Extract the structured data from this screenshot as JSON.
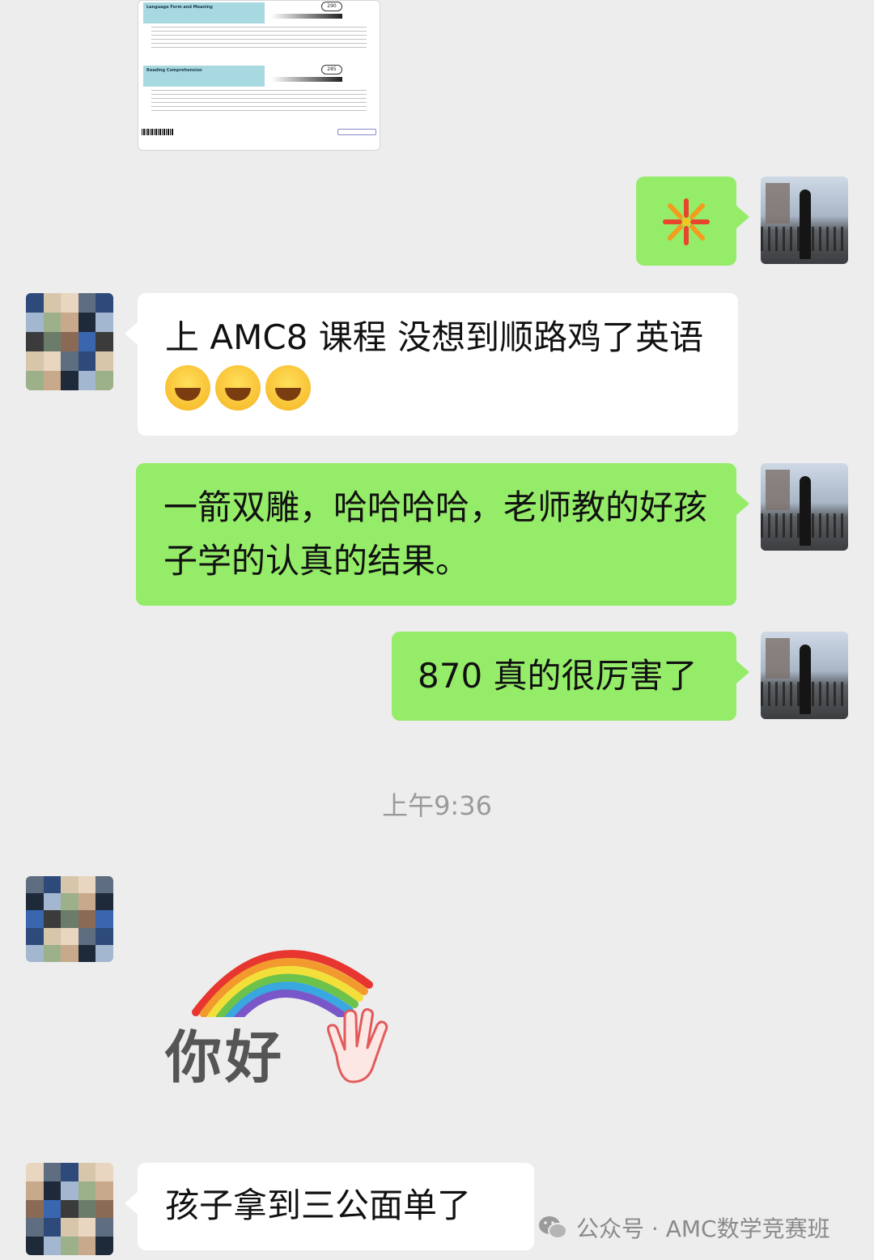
{
  "messages": {
    "m1_text": "上 AMC8 课程 没想到顺路鸡了英语",
    "m2_text": "一箭双雕，哈哈哈哈，老师教的好孩子学的认真的结果。",
    "m3_text": "870 真的很厉害了",
    "m4_text": "孩子拿到三公面单了"
  },
  "timestamp": "上午9:36",
  "sticker": {
    "text": "你好"
  },
  "watermark": {
    "text": "公众号 · AMC数学竞赛班"
  },
  "report": {
    "section1_title": "Language Form and Meaning",
    "section1_score": "290",
    "section2_title": "Reading Comprehension",
    "section2_score": "285"
  },
  "colors": {
    "out_bubble": "#95ec69",
    "in_bubble": "#ffffff",
    "background": "#ededed"
  }
}
